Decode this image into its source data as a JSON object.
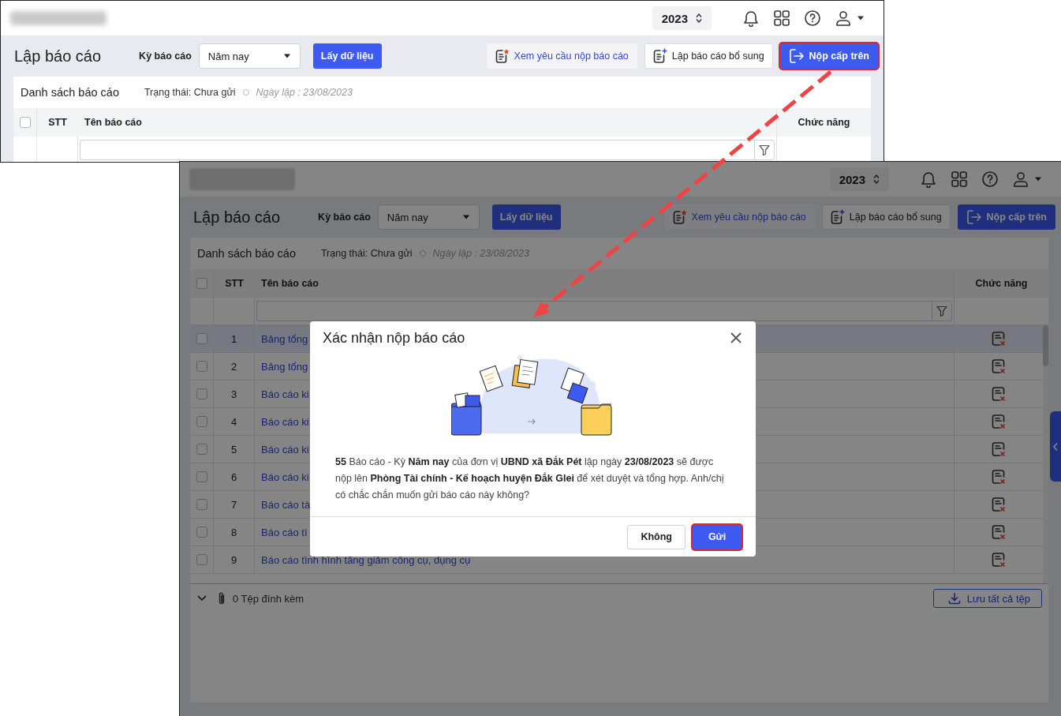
{
  "top_window": {
    "header": {
      "year": "2023"
    },
    "toolbar": {
      "title": "Lập báo cáo",
      "period_label": "Kỳ báo cáo",
      "period_value": "Năm nay",
      "fetch_button": "Lấy dữ liệu",
      "actions": [
        {
          "label": "Xem yêu cầu nộp báo cáo",
          "kind": "request",
          "highlighted": false
        },
        {
          "label": "Lập báo cáo bổ sung",
          "kind": "supplement",
          "highlighted": false
        },
        {
          "label": "Nộp cấp trên",
          "kind": "submit",
          "highlighted": true
        }
      ]
    },
    "panel": {
      "title": "Danh sách báo cáo",
      "status": "Trạng thái: Chưa gửi",
      "date": "Ngày lập : 23/08/2023"
    },
    "table": {
      "header_checked": false,
      "columns": [
        "STT",
        "Tên báo cáo",
        "Chức năng"
      ]
    }
  },
  "bottom_window": {
    "dimmed": true,
    "header": {
      "year": "2023"
    },
    "toolbar": {
      "title": "Lập báo cáo",
      "period_label": "Kỳ báo cáo",
      "period_value": "Năm nay",
      "fetch_button": "Lấy dữ liệu",
      "actions": [
        {
          "label": "Xem yêu cầu nộp báo cáo",
          "kind": "request",
          "highlighted": false
        },
        {
          "label": "Lập báo cáo bổ sung",
          "kind": "supplement",
          "highlighted": false
        },
        {
          "label": "Nộp cấp trên",
          "kind": "submit",
          "highlighted": false
        }
      ]
    },
    "panel": {
      "title": "Danh sách báo cáo",
      "status": "Trạng thái: Chưa gửi",
      "date": "Ngày lập : 23/08/2023"
    },
    "table": {
      "header_checked": false,
      "columns": [
        "STT",
        "Tên báo cáo",
        "Chức năng"
      ],
      "rows": [
        {
          "stt": "1",
          "name": "Bảng tổng",
          "checked": false,
          "selected": true
        },
        {
          "stt": "2",
          "name": "Bảng tổng",
          "checked": false,
          "selected": false
        },
        {
          "stt": "3",
          "name": "Báo cáo ki",
          "checked": false,
          "selected": false
        },
        {
          "stt": "4",
          "name": "Báo cáo ki",
          "checked": false,
          "selected": false
        },
        {
          "stt": "5",
          "name": "Báo cáo ki",
          "checked": false,
          "selected": false
        },
        {
          "stt": "6",
          "name": "Báo cáo ki",
          "checked": false,
          "selected": false
        },
        {
          "stt": "7",
          "name": "Báo cáo tà",
          "checked": false,
          "selected": false
        },
        {
          "stt": "8",
          "name": "Báo cáo tì",
          "checked": false,
          "selected": false
        },
        {
          "stt": "9",
          "name": "Báo cáo tình hình tăng giảm công cụ, dụng cụ",
          "checked": false,
          "selected": false
        }
      ]
    },
    "footer": {
      "attachments": "0 Tệp đính kèm",
      "save_all": "Lưu tất cả tệp"
    },
    "dialog": {
      "title": "Xác nhận nộp báo cáo",
      "message": "**55** Báo cáo - Kỳ **Năm nay** của đơn vị **UBND xã Đắk Pét** lập ngày **23/08/2023** sẽ được nộp lên **Phòng Tài chính - Kế hoạch huyện Đắk Glei** để xét duyệt và tổng hợp. Anh/chị có chắc chắn muốn gửi báo cáo này không?",
      "buttons": [
        {
          "label": "Không",
          "kind": "secondary",
          "highlighted": false
        },
        {
          "label": "Gửi",
          "kind": "primary",
          "highlighted": true
        }
      ]
    }
  }
}
